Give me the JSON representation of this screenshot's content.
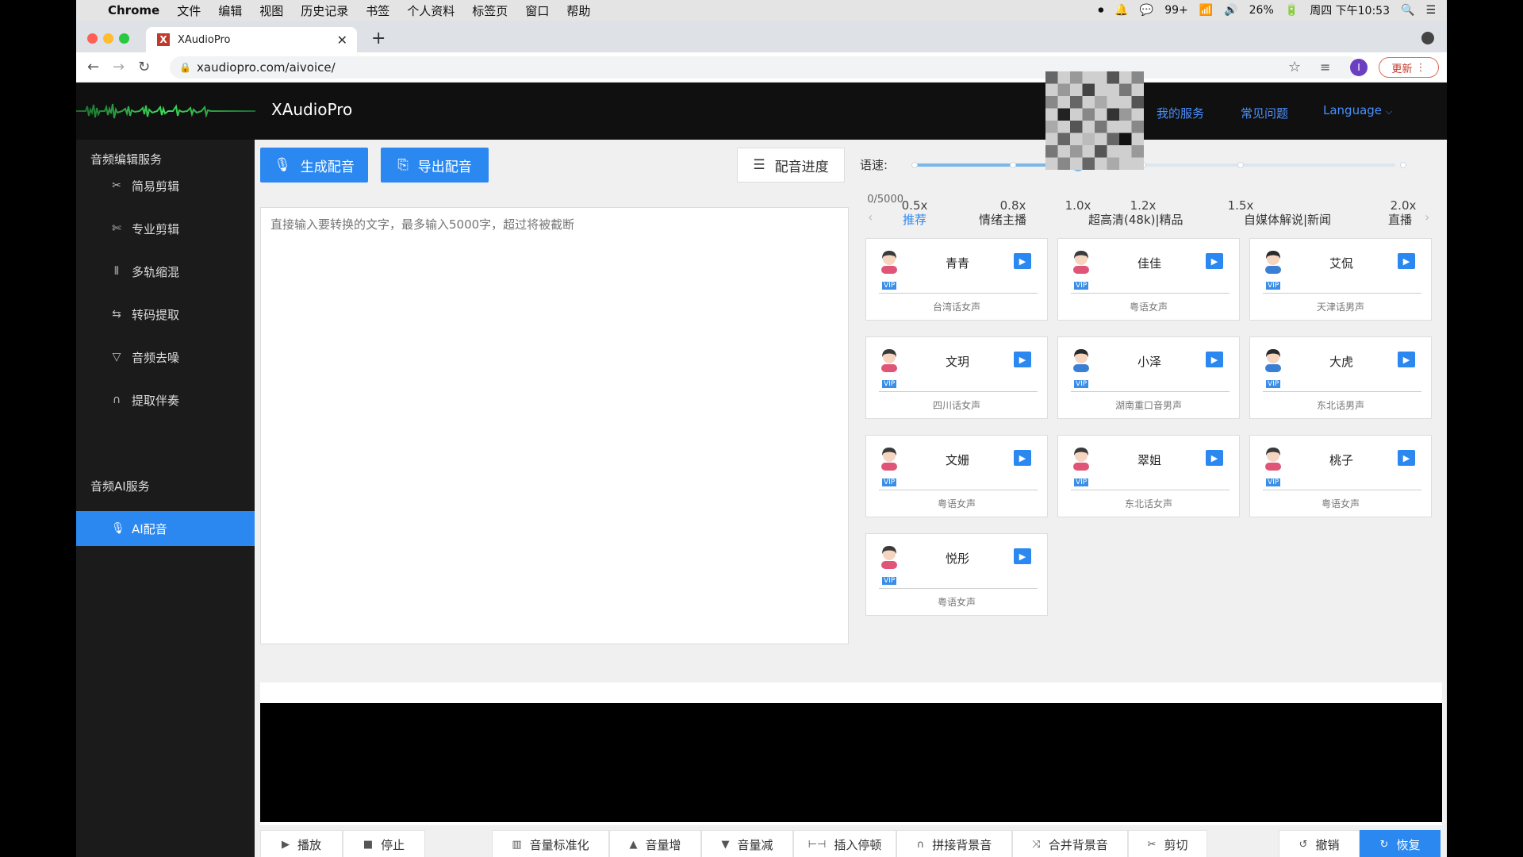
{
  "menubar": {
    "app": "Chrome",
    "items": [
      "文件",
      "编辑",
      "视图",
      "历史记录",
      "书签",
      "个人资料",
      "标签页",
      "窗口",
      "帮助"
    ],
    "badge": "99+",
    "battery": "26%",
    "clock": "周四 下午10:53"
  },
  "browser": {
    "tab_title": "XAudioPro",
    "url": "xaudiopro.com/aivoice/",
    "profile_initial": "I",
    "update_label": "更新"
  },
  "header": {
    "brand": "XAudioPro",
    "links": [
      "我的服务",
      "常见问题"
    ],
    "language": "Language"
  },
  "sidebar": {
    "group1": "音频编辑服务",
    "items": [
      {
        "label": "简易剪辑",
        "icon": "scissors-icon"
      },
      {
        "label": "专业剪辑",
        "icon": "cut-icon"
      },
      {
        "label": "多轨缩混",
        "icon": "mixer-icon"
      },
      {
        "label": "转码提取",
        "icon": "convert-icon"
      },
      {
        "label": "音频去噪",
        "icon": "filter-icon"
      },
      {
        "label": "提取伴奏",
        "icon": "headphones-icon"
      }
    ],
    "group2": "音频AI服务",
    "active_item": {
      "label": "AI配音",
      "icon": "mic-icon"
    },
    "accent": "#2b88f0"
  },
  "toolbar": {
    "generate": "生成配音",
    "export": "导出配音",
    "progress": "配音进度"
  },
  "editor": {
    "counter": "0/5000",
    "placeholder": "直接输入要转换的文字，最多输入5000字，超过将被截断"
  },
  "speed": {
    "label": "语速:",
    "options": [
      "0.5x",
      "0.8x",
      "1.0x",
      "1.2x",
      "1.5x",
      "2.0x"
    ],
    "selected": "1.0x"
  },
  "voice_tabs": {
    "items": [
      "推荐",
      "情绪主播",
      "超高清(48k)|精品",
      "自媒体解说|新闻",
      "直播"
    ],
    "active": "推荐"
  },
  "voices": [
    {
      "name": "青青",
      "desc": "台湾话女声",
      "gender": "female",
      "vip": "VIP"
    },
    {
      "name": "佳佳",
      "desc": "粤语女声",
      "gender": "female",
      "vip": "VIP"
    },
    {
      "name": "艾侃",
      "desc": "天津话男声",
      "gender": "male",
      "vip": "VIP"
    },
    {
      "name": "文玥",
      "desc": "四川话女声",
      "gender": "female",
      "vip": "VIP"
    },
    {
      "name": "小泽",
      "desc": "湖南重口音男声",
      "gender": "male",
      "vip": "VIP"
    },
    {
      "name": "大虎",
      "desc": "东北话男声",
      "gender": "male",
      "vip": "VIP"
    },
    {
      "name": "文姗",
      "desc": "粤语女声",
      "gender": "female",
      "vip": "VIP"
    },
    {
      "name": "翠姐",
      "desc": "东北话女声",
      "gender": "female",
      "vip": "VIP"
    },
    {
      "name": "桃子",
      "desc": "粤语女声",
      "gender": "female",
      "vip": "VIP"
    },
    {
      "name": "悦彤",
      "desc": "粤语女声",
      "gender": "female",
      "vip": "VIP"
    }
  ],
  "bottom_toolbar": {
    "play": "播放",
    "stop": "停止",
    "normalize": "音量标准化",
    "vol_up": "音量增",
    "vol_down": "音量减",
    "insert_pause": "插入停顿",
    "splice_bg": "拼接背景音",
    "merge_bg": "合并背景音",
    "cut": "剪切",
    "undo": "撤销",
    "redo": "恢复"
  }
}
